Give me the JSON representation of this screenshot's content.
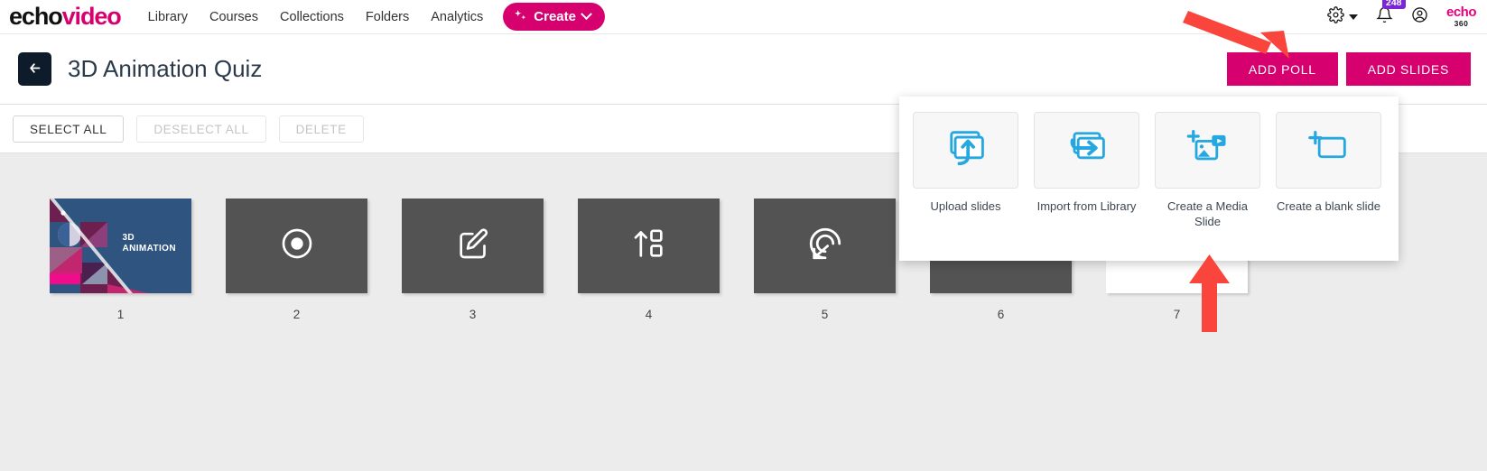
{
  "nav": {
    "brand_echo": "echo",
    "brand_video": "video",
    "links": [
      {
        "label": "Library"
      },
      {
        "label": "Courses"
      },
      {
        "label": "Collections"
      },
      {
        "label": "Folders"
      },
      {
        "label": "Analytics"
      }
    ],
    "create_label": "Create",
    "notification_count": "248",
    "logo_top": "echo",
    "logo_bottom": "360",
    "accent_color": "#d6006e",
    "badge_color": "#7b26d6"
  },
  "title_bar": {
    "title": "3D Animation Quiz",
    "add_poll_label": "ADD POLL",
    "add_slides_label": "ADD SLIDES"
  },
  "toolbar": {
    "select_all_label": "SELECT ALL",
    "deselect_all_label": "DESELECT ALL",
    "delete_label": "DELETE"
  },
  "slides": [
    {
      "number": "1",
      "kind": "title-art",
      "art_text_line1": "3D",
      "art_text_line2": "ANIMATION"
    },
    {
      "number": "2",
      "kind": "multiple-choice",
      "icon": "radio-button-icon"
    },
    {
      "number": "3",
      "kind": "short-answer",
      "icon": "pencil-square-icon"
    },
    {
      "number": "4",
      "kind": "ordering",
      "icon": "arrow-up-square-icon"
    },
    {
      "number": "5",
      "kind": "hotspot",
      "icon": "target-cursor-icon"
    },
    {
      "number": "6",
      "kind": "question",
      "icon": ""
    },
    {
      "number": "7",
      "kind": "blank",
      "icon": ""
    }
  ],
  "add_slides_menu": {
    "items": [
      {
        "label": "Upload slides",
        "icon": "upload-slides-icon"
      },
      {
        "label": "Import from Library",
        "icon": "import-library-icon"
      },
      {
        "label": "Create a Media Slide",
        "icon": "create-media-slide-icon"
      },
      {
        "label": "Create a blank slide",
        "icon": "create-blank-slide-icon"
      }
    ],
    "icon_color": "#25a7e0"
  },
  "annotations": {
    "arrow_color": "#f9453c",
    "arrow_to_add_slides": "arrow-pointing-add-slides",
    "arrow_to_media_slide": "arrow-pointing-create-media-slide"
  }
}
